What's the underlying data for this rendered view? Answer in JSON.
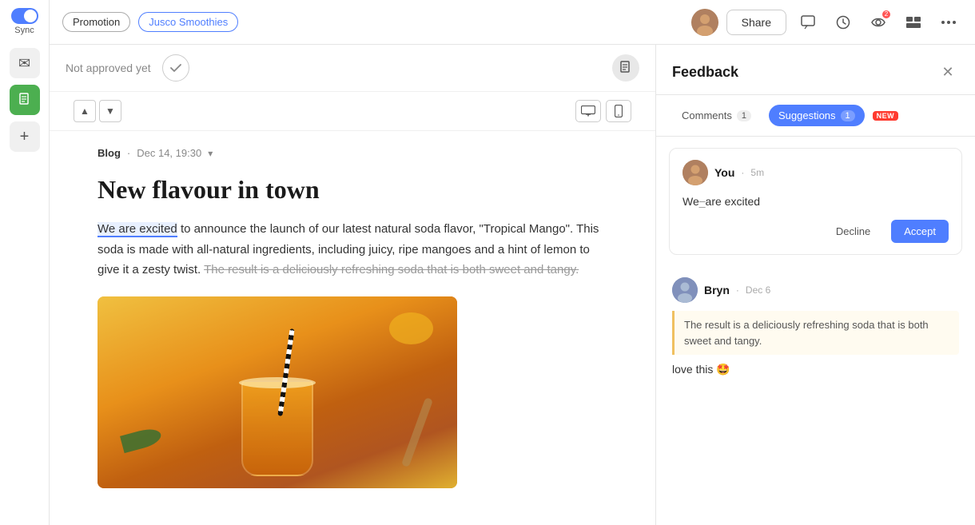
{
  "sidebar": {
    "sync_label": "Sync",
    "icons": [
      "✉",
      "📄",
      "+"
    ]
  },
  "topbar": {
    "promotion_tag": "Promotion",
    "brand_tag": "Jusco Smoothies",
    "share_label": "Share",
    "icons": [
      "💬",
      "🕐",
      "👁",
      "⬛",
      "⋯"
    ]
  },
  "approval": {
    "not_approved_text": "Not approved yet"
  },
  "document": {
    "meta_blog": "Blog",
    "meta_date": "Dec 14, 19:30",
    "title": "New flavour in town",
    "body_part1": "We are excited",
    "body_part2": " to announce the launch of our latest natural soda flavor, \"Tropical Mango\". This soda is made with all-natural ingredients, including juicy, ripe mangoes and a hint of lemon to give it a zesty twist. ",
    "body_strikethrough": "The result is a deliciously refreshing soda that is both sweet and tangy.",
    "body_period": ""
  },
  "feedback": {
    "title": "Feedback",
    "close_icon": "✕",
    "tabs": [
      {
        "label": "Comments",
        "count": "1",
        "active": false
      },
      {
        "label": "Suggestions",
        "count": "1",
        "active": true,
        "badge": "NEW"
      }
    ],
    "suggestions": [
      {
        "user": "You",
        "time": "5m",
        "avatar_color": "#c0a080",
        "text_before": "We",
        "del_text": "̲",
        "suggestion": "We are excited",
        "decline_label": "Decline",
        "accept_label": "Accept"
      }
    ],
    "comments": [
      {
        "user": "Bryn",
        "date": "Dec 6",
        "avatar_color": "#8899cc",
        "quote": "The result is a deliciously refreshing soda that is both sweet and tangy.",
        "text": "love this 🤩"
      }
    ]
  }
}
